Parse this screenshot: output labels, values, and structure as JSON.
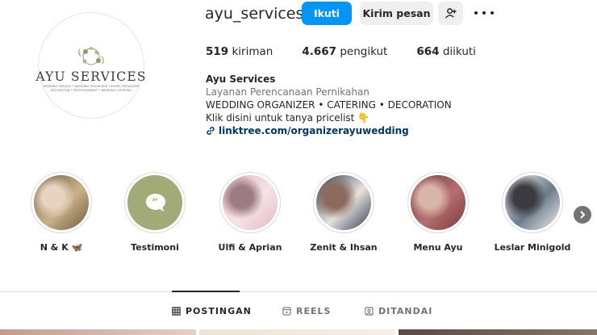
{
  "profile": {
    "username": "ayu_services",
    "logo": {
      "name": "AYU SERVICES",
      "line1": "WEDDING SERVICE • WEDDING ORGANIZER • EVENT ORGANIZER",
      "line2": "DECORATION • ENTERTAINMENT • WEDDING CATERING"
    }
  },
  "actions": {
    "follow": "Ikuti",
    "message": "Kirim pesan",
    "suggest_icon": "add-person-icon",
    "more_icon": "more-dots-icon"
  },
  "stats": {
    "posts_count": "519",
    "posts_label": "kiriman",
    "followers_count": "4.667",
    "followers_label": "pengikut",
    "following_count": "664",
    "following_label": "diikuti"
  },
  "bio": {
    "name": "Ayu Services",
    "category": "Layanan Perencanaan Pernikahan",
    "line1": "WEDDING ORGANIZER • CATERING • DECORATION",
    "line2": "Klik disini untuk tanya pricelist 👇",
    "link": "linktree.com/organizerayuwedding"
  },
  "highlights": [
    {
      "label": "N & K 🦋",
      "colors": [
        "#6b5a3d",
        "#c9b38a",
        "#e7d3c0"
      ]
    },
    {
      "label": "Testimoni",
      "colors": [
        "#a0ab77",
        "#a0ab77",
        "#a0ab77"
      ]
    },
    {
      "label": "Ulfi & Aprian",
      "colors": [
        "#e6b7c2",
        "#f3e4e4",
        "#9c7b84"
      ]
    },
    {
      "label": "Zenit & Ihsan",
      "colors": [
        "#2e3b55",
        "#e8e2dc",
        "#8b6b5e"
      ]
    },
    {
      "label": "Menu Ayu",
      "colors": [
        "#7a3a3f",
        "#b46f6f",
        "#d9b5a9"
      ]
    },
    {
      "label": "Leslar Minigold",
      "colors": [
        "#f2eee9",
        "#6b7c8c",
        "#3a3a40"
      ]
    }
  ],
  "tabs": [
    {
      "label": "POSTINGAN",
      "icon": "grid-icon",
      "active": true
    },
    {
      "label": "REELS",
      "icon": "reels-icon",
      "active": false
    },
    {
      "label": "DITANDAI",
      "icon": "tagged-icon",
      "active": false
    }
  ]
}
